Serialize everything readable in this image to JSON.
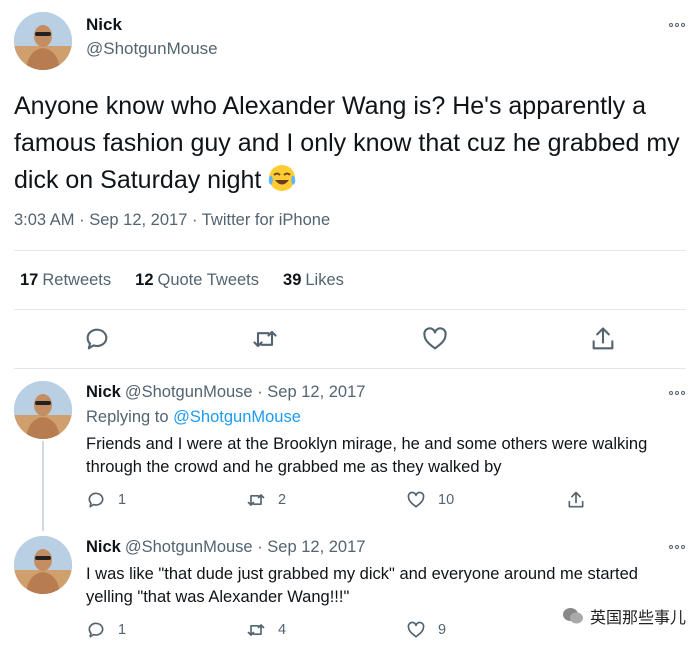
{
  "main_tweet": {
    "name": "Nick",
    "handle": "@ShotgunMouse",
    "text": "Anyone know who Alexander Wang is? He's apparently a famous fashion guy and I only know that cuz he grabbed my dick on Saturday night",
    "emoji": "😂",
    "meta": "3:03 AM · Sep 12, 2017 · Twitter for iPhone",
    "stats": {
      "retweets_count": "17",
      "retweets_label": "Retweets",
      "quote_count": "12",
      "quote_label": "Quote Tweets",
      "likes_count": "39",
      "likes_label": "Likes"
    }
  },
  "replies": [
    {
      "name": "Nick",
      "header": "@ShotgunMouse · Sep 12, 2017",
      "replying_prefix": "Replying to",
      "replying_to": "@ShotgunMouse",
      "text": "Friends and I were at the Brooklyn mirage, he and some others were walking through the crowd and he grabbed me as they walked by",
      "reply_count": "1",
      "retweet_count": "2",
      "like_count": "10"
    },
    {
      "name": "Nick",
      "header": "@ShotgunMouse · Sep 12, 2017",
      "text": "I was like \"that dude just grabbed my dick\" and everyone around me started yelling \"that was Alexander Wang!!!\"",
      "reply_count": "1",
      "retweet_count": "4",
      "like_count": "9"
    }
  ],
  "watermark": {
    "text": "英国那些事儿"
  },
  "colors": {
    "text": "#0f1419",
    "secondary": "#536471",
    "link": "#1d9bf0",
    "divider": "#e1e8ed"
  }
}
